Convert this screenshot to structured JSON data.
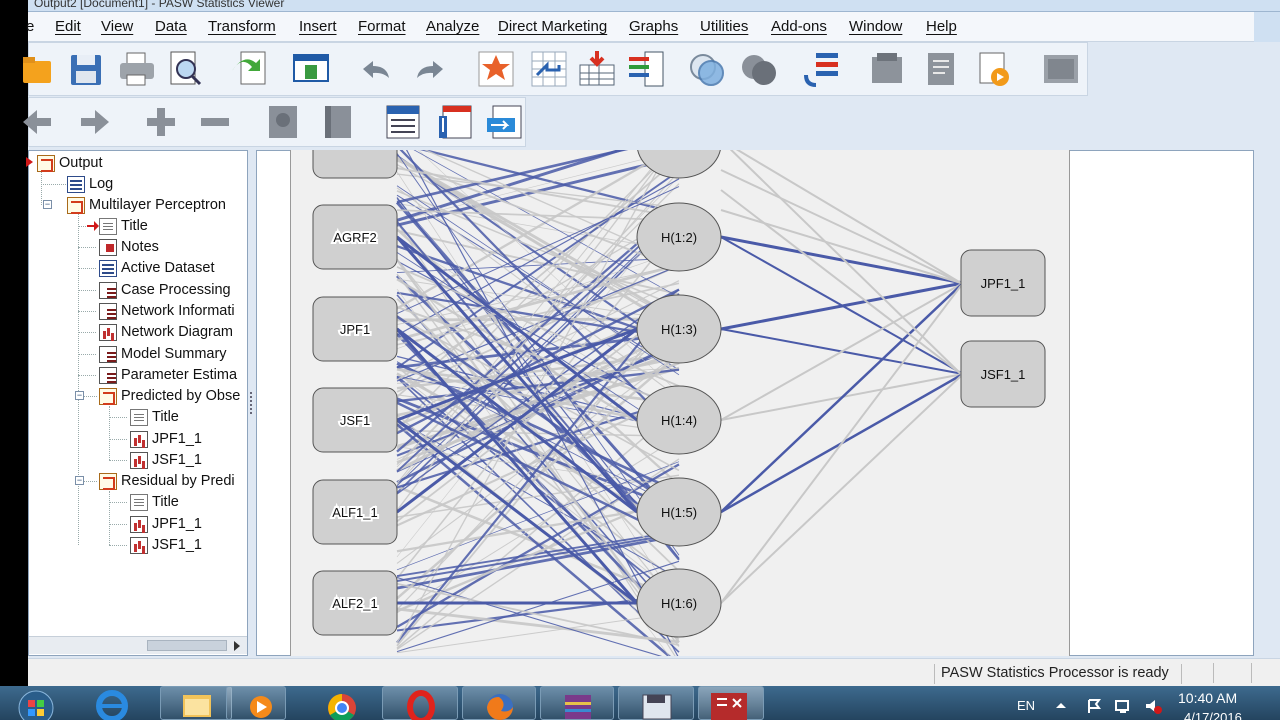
{
  "window": {
    "title": "Output2 [Document1] - PASW Statistics Viewer"
  },
  "menu": [
    "Edit",
    "View",
    "Data",
    "Transform",
    "Insert",
    "Format",
    "Analyze",
    "Direct Marketing",
    "Graphs",
    "Utilities",
    "Add-ons",
    "Window",
    "Help"
  ],
  "menu_partial": "e",
  "nav": {
    "items": [
      {
        "label": "Output",
        "icon": "output-book-icon"
      },
      {
        "label": "Log",
        "icon": "log-icon"
      },
      {
        "label": "Multilayer Perceptron",
        "icon": "procedure-book-icon"
      },
      {
        "label": "Title",
        "icon": "title-icon"
      },
      {
        "label": "Notes",
        "icon": "notes-icon"
      },
      {
        "label": "Active Dataset",
        "icon": "dataset-icon"
      },
      {
        "label": "Case Processing",
        "icon": "table-icon"
      },
      {
        "label": "Network Informati",
        "icon": "table-icon"
      },
      {
        "label": "Network Diagram",
        "icon": "chart-icon"
      },
      {
        "label": "Model Summary",
        "icon": "table-icon"
      },
      {
        "label": "Parameter Estima",
        "icon": "table-icon"
      },
      {
        "label": "Predicted by Obse",
        "icon": "folder-book-icon"
      },
      {
        "label": "Title",
        "icon": "title-icon"
      },
      {
        "label": "JPF1_1",
        "icon": "chart-icon"
      },
      {
        "label": "JSF1_1",
        "icon": "chart-icon"
      },
      {
        "label": "Residual by Predi",
        "icon": "folder-book-icon"
      },
      {
        "label": "Title",
        "icon": "title-icon"
      },
      {
        "label": "JPF1_1",
        "icon": "chart-icon"
      },
      {
        "label": "JSF1_1",
        "icon": "chart-icon"
      }
    ]
  },
  "diagram": {
    "input_nodes": [
      "AGRF2",
      "JPF1",
      "JSF1",
      "ALF1_1",
      "ALF2_1"
    ],
    "hidden_nodes": [
      "H(1:2)",
      "H(1:3)",
      "H(1:4)",
      "H(1:5)",
      "H(1:6)"
    ],
    "output_nodes": [
      "JPF1_1",
      "JSF1_1"
    ],
    "colors": {
      "positive": "#4a5aa8",
      "negative": "#c8c8c8",
      "node_fill": "#d0d0d0"
    }
  },
  "status": {
    "text": "PASW Statistics Processor is ready"
  },
  "taskbar": {
    "language": "EN",
    "time": "10:40 AM",
    "date": "4/17/2016"
  }
}
